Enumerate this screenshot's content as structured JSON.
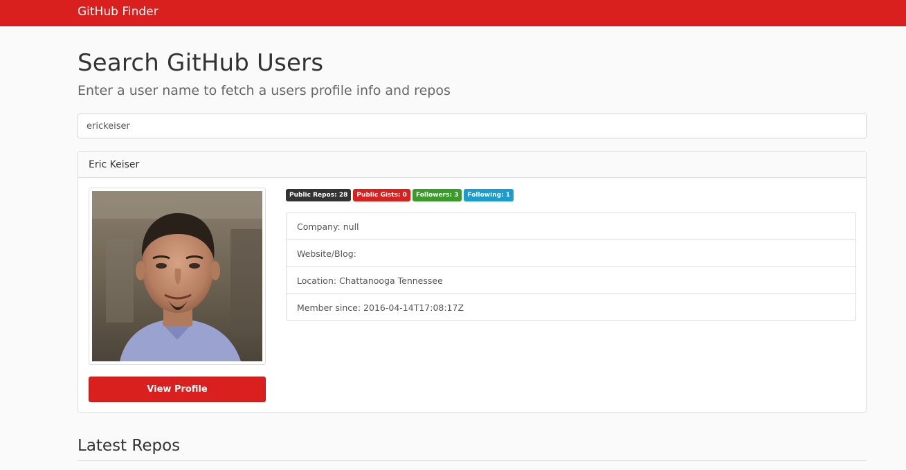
{
  "navbar": {
    "brand": "GitHub Finder",
    "color": "#d9201f"
  },
  "header": {
    "title": "Search GitHub Users",
    "subtitle": "Enter a user name to fetch a users profile info and repos"
  },
  "search": {
    "value": "erickeiser"
  },
  "profile": {
    "name": "Eric Keiser",
    "badges": [
      {
        "label": "Public Repos: 28",
        "color": "#333333"
      },
      {
        "label": "Public Gists: 0",
        "color": "#d9201f"
      },
      {
        "label": "Followers: 3",
        "color": "#3a9b2b"
      },
      {
        "label": "Following: 1",
        "color": "#1b9bd0"
      }
    ],
    "details": [
      "Company: null",
      "Website/Blog:",
      "Location: Chattanooga Tennessee",
      "Member since: 2016-04-14T17:08:17Z"
    ],
    "view_profile_label": "View Profile"
  },
  "repos": {
    "heading": "Latest Repos"
  }
}
